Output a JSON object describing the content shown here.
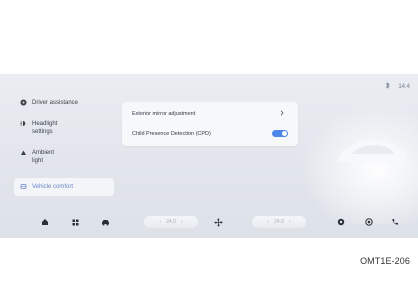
{
  "status": {
    "bluetooth_icon": "bluetooth-icon",
    "time": "14:4"
  },
  "sidebar": {
    "items": [
      {
        "label": "Driver assistance",
        "icon": "steering-wheel-icon"
      },
      {
        "label": "Headlight settings",
        "icon": "headlight-icon"
      },
      {
        "label": "Ambient light",
        "icon": "ambient-light-icon"
      },
      {
        "label": "Vehicle comfort",
        "icon": "seat-icon",
        "active": true
      }
    ]
  },
  "panel": {
    "rows": [
      {
        "label": "Exterior mirror adjustment",
        "control": "chevron"
      },
      {
        "label": "Child Presence Detection (CPD)",
        "control": "toggle",
        "state": "on"
      }
    ]
  },
  "dock": {
    "left_icons": [
      "home-icon",
      "apps-grid-icon",
      "car-icon"
    ],
    "temp_left": "24.0",
    "fan_icon": "fan-icon",
    "temp_right": "24.0",
    "right_icons": [
      "settings-icon",
      "media-icon",
      "phone-icon"
    ]
  },
  "caption": "OMT1E-206"
}
